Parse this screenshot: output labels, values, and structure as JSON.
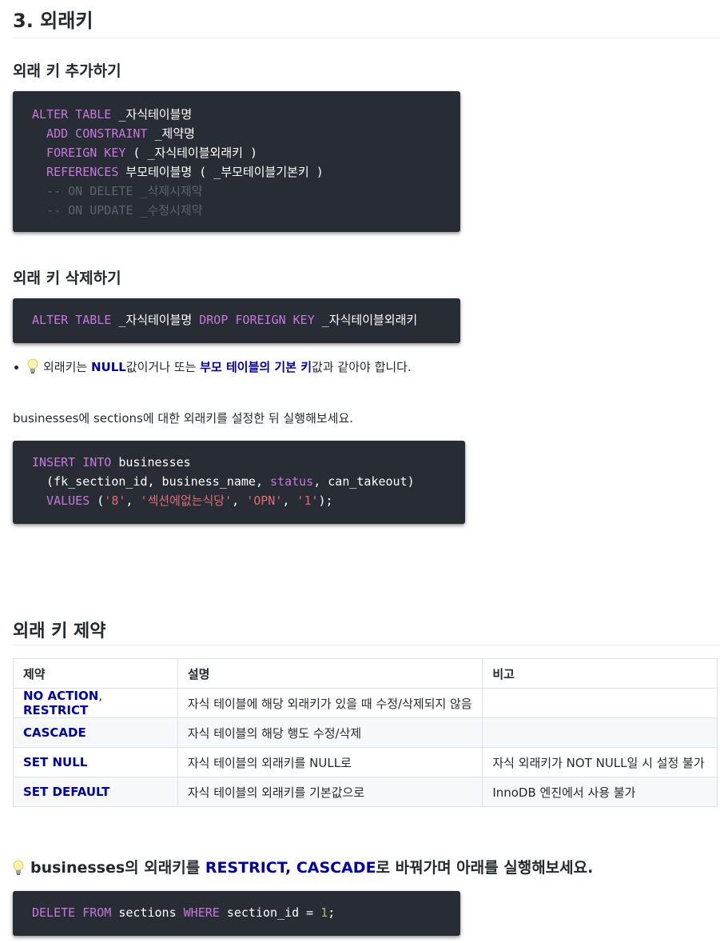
{
  "heading_main": "3. 외래키",
  "section_add": {
    "title": "외래 키 추가하기",
    "code": [
      [
        {
          "t": "ALTER TABLE",
          "c": "kw"
        },
        {
          "t": " _자식테이블명",
          "c": ""
        }
      ],
      [
        {
          "t": "  ADD CONSTRAINT",
          "c": "kw"
        },
        {
          "t": " _제약명",
          "c": ""
        }
      ],
      [
        {
          "t": "  FOREIGN KEY",
          "c": "kw"
        },
        {
          "t": " ( _자식테이블외래키 )",
          "c": ""
        }
      ],
      [
        {
          "t": "  REFERENCES",
          "c": "kw"
        },
        {
          "t": " 부모테이블명 ( _부모테이블기본키 )",
          "c": ""
        }
      ],
      [
        {
          "t": "  -- ON DELETE _삭제시제약",
          "c": "cm"
        }
      ],
      [
        {
          "t": "  -- ON UPDATE _수정시제약",
          "c": "cm"
        }
      ]
    ]
  },
  "section_delete": {
    "title": "외래 키 삭제하기",
    "code": [
      [
        {
          "t": "ALTER TABLE",
          "c": "kw"
        },
        {
          "t": " _자식테이블명 ",
          "c": ""
        },
        {
          "t": "DROP FOREIGN KEY",
          "c": "kw"
        },
        {
          "t": " _자식테이블외래키",
          "c": ""
        }
      ]
    ]
  },
  "tip": {
    "icon": "lightbulb-icon",
    "text_1": "외래키는 ",
    "hl_1": "NULL",
    "text_2": "값이거나 또는 ",
    "hl_2": "부모 테이블의 기본 키",
    "text_3": "값과 같아야 합니다."
  },
  "instruction": "businesses에 sections에 대한 외래키를 설정한 뒤 실행해보세요.",
  "insert_code": [
    [
      {
        "t": "INSERT INTO",
        "c": "kw"
      },
      {
        "t": " businesses",
        "c": ""
      }
    ],
    [
      {
        "t": "  (fk_section_id, business_name, ",
        "c": ""
      },
      {
        "t": "status",
        "c": "kw"
      },
      {
        "t": ", can_takeout)",
        "c": ""
      }
    ],
    [
      {
        "t": "  VALUES",
        "c": "kw"
      },
      {
        "t": " (",
        "c": ""
      },
      {
        "t": "'8'",
        "c": "str"
      },
      {
        "t": ", ",
        "c": ""
      },
      {
        "t": "'섹션에없는식당'",
        "c": "str"
      },
      {
        "t": ", ",
        "c": ""
      },
      {
        "t": "'OPN'",
        "c": "str"
      },
      {
        "t": ", ",
        "c": ""
      },
      {
        "t": "'1'",
        "c": "str"
      },
      {
        "t": ");",
        "c": ""
      }
    ]
  ],
  "section_constraint": {
    "title": "외래 키 제약",
    "headers": [
      "제약",
      "설명",
      "비고"
    ],
    "rows": [
      {
        "name_1": "NO ACTION",
        "sep": ", ",
        "name_2": "RESTRICT",
        "desc": "자식 테이블에 해당 외래키가 있을 때 수정/삭제되지 않음",
        "note": ""
      },
      {
        "name_1": "CASCADE",
        "sep": "",
        "name_2": "",
        "desc": "자식 테이블의 해당 행도 수정/삭제",
        "note": ""
      },
      {
        "name_1": "SET NULL",
        "sep": "",
        "name_2": "",
        "desc": "자식 테이블의 외래키를 NULL로",
        "note": "자식 외래키가 NOT NULL일 시 설정 불가"
      },
      {
        "name_1": "SET DEFAULT",
        "sep": "",
        "name_2": "",
        "desc": "자식 테이블의 외래키를 기본값으로",
        "note": "InnoDB 엔진에서 사용 불가"
      }
    ]
  },
  "final_note": {
    "icon": "lightbulb-icon",
    "text_1": "businesses의 외래키를 ",
    "hl_1": "RESTRICT",
    "sep": ", ",
    "hl_2": "CASCADE",
    "text_2": "로 바꿔가며 아래를 실행해보세요."
  },
  "final_code": [
    [
      {
        "t": "DELETE FROM",
        "c": "kw"
      },
      {
        "t": " sections ",
        "c": ""
      },
      {
        "t": "WHERE",
        "c": "kw"
      },
      {
        "t": " section_id = ",
        "c": ""
      },
      {
        "t": "1",
        "c": "num"
      },
      {
        "t": ";",
        "c": ""
      }
    ]
  ]
}
